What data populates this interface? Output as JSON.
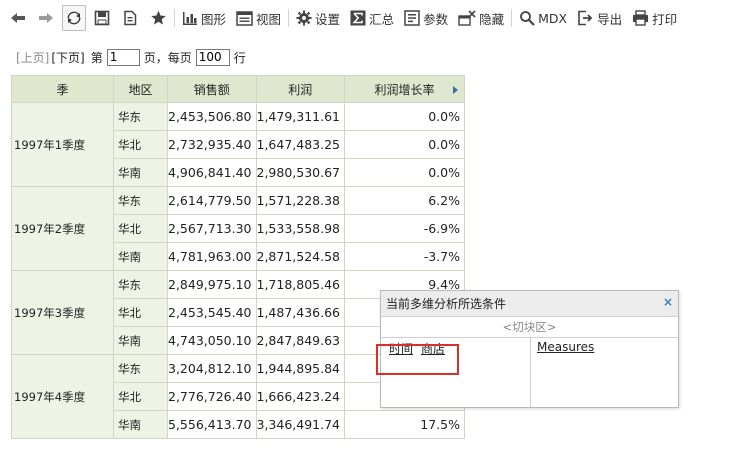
{
  "toolbar": {
    "back_icon": "arrow-left-icon",
    "forward_icon": "arrow-right-icon",
    "refresh_icon": "refresh-icon",
    "save_icon": "save-icon",
    "save_as_icon": "save-as-icon",
    "favorite_icon": "star-icon",
    "chart_label": "图形",
    "view_label": "视图",
    "settings_label": "设置",
    "summary_label": "汇总",
    "params_label": "参数",
    "hide_label": "隐藏",
    "mdx_label": "MDX",
    "export_label": "导出",
    "print_label": "打印"
  },
  "pager": {
    "prev_label": "[上页]",
    "next_label": "[下页]",
    "page_prefix": "第",
    "page_value": "1",
    "page_suffix": "页，每页",
    "page_size_value": "100",
    "rows_suffix": "行"
  },
  "table": {
    "headers": [
      "季",
      "地区",
      "销售额",
      "利润",
      "利润增长率"
    ],
    "groups": [
      {
        "season": "1997年1季度",
        "rows": [
          {
            "region": "华东",
            "sales": "2,453,506.80",
            "profit": "1,479,311.61",
            "growth": "0.0%"
          },
          {
            "region": "华北",
            "sales": "2,732,935.40",
            "profit": "1,647,483.25",
            "growth": "0.0%"
          },
          {
            "region": "华南",
            "sales": "4,906,841.40",
            "profit": "2,980,530.67",
            "growth": "0.0%"
          }
        ]
      },
      {
        "season": "1997年2季度",
        "rows": [
          {
            "region": "华东",
            "sales": "2,614,779.50",
            "profit": "1,571,228.38",
            "growth": "6.2%"
          },
          {
            "region": "华北",
            "sales": "2,567,713.30",
            "profit": "1,533,558.98",
            "growth": "-6.9%"
          },
          {
            "region": "华南",
            "sales": "4,781,963.00",
            "profit": "2,871,524.58",
            "growth": "-3.7%"
          }
        ]
      },
      {
        "season": "1997年3季度",
        "rows": [
          {
            "region": "华东",
            "sales": "2,849,975.10",
            "profit": "1,718,805.46",
            "growth": "9.4%"
          },
          {
            "region": "华北",
            "sales": "2,453,545.40",
            "profit": "1,487,436.66",
            "growth": ""
          },
          {
            "region": "华南",
            "sales": "4,743,050.10",
            "profit": "2,847,849.63",
            "growth": ""
          }
        ]
      },
      {
        "season": "1997年4季度",
        "rows": [
          {
            "region": "华东",
            "sales": "3,204,812.10",
            "profit": "1,944,895.84",
            "growth": ""
          },
          {
            "region": "华北",
            "sales": "2,776,726.40",
            "profit": "1,666,423.24",
            "growth": ""
          },
          {
            "region": "华南",
            "sales": "5,556,413.70",
            "profit": "3,346,491.74",
            "growth": "17.5%"
          }
        ]
      }
    ]
  },
  "popup": {
    "title": "当前多维分析所选条件",
    "close_glyph": "×",
    "zone_label": "<切块区>",
    "left_items": [
      "时间",
      "商店"
    ],
    "right_items": [
      "Measures"
    ]
  }
}
